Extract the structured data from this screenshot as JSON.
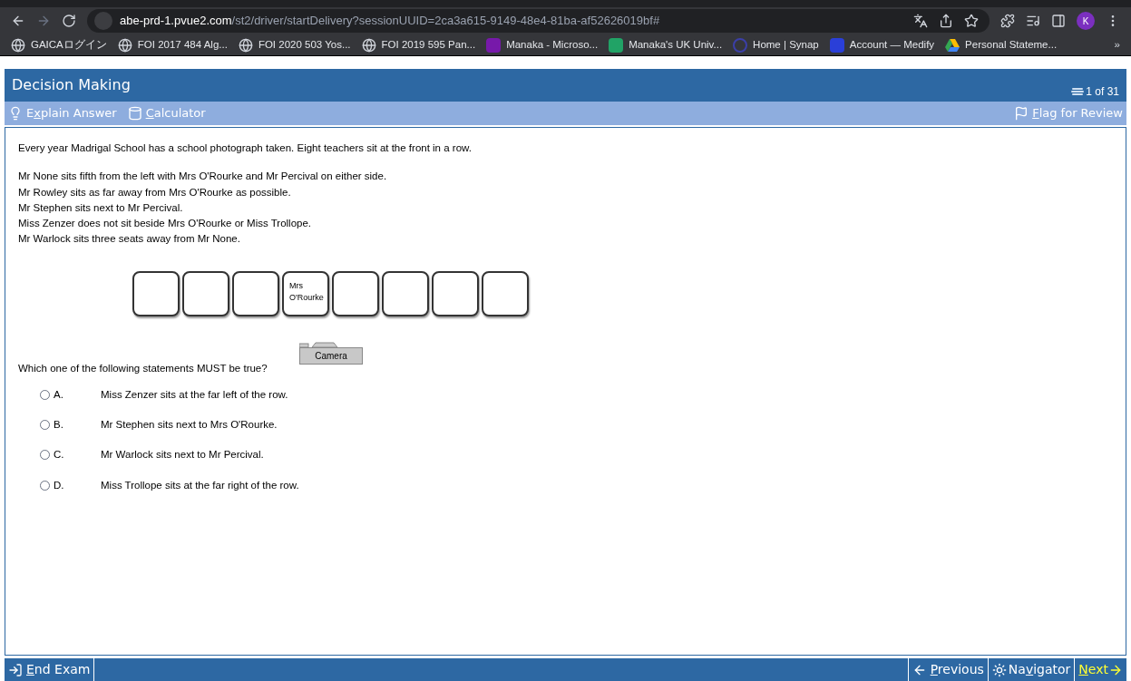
{
  "browser": {
    "url_host": "abe-prd-1.pvue2.com",
    "url_path": "/st2/driver/startDelivery?sessionUUID=2ca3a615-9149-48e4-81ba-af52626019bf#",
    "profile_initial": "K",
    "bookmarks": [
      {
        "label": "GAICAログイン",
        "kind": "globe"
      },
      {
        "label": "FOI 2017 484 Alg...",
        "kind": "globe"
      },
      {
        "label": "FOI 2020 503 Yos...",
        "kind": "globe"
      },
      {
        "label": "FOI 2019 595 Pan...",
        "kind": "globe"
      },
      {
        "label": "Manaka - Microso...",
        "kind": "onenote"
      },
      {
        "label": "Manaka's UK Univ...",
        "kind": "sheet"
      },
      {
        "label": "Home | Synap",
        "kind": "synap"
      },
      {
        "label": "Account — Medify",
        "kind": "medify"
      },
      {
        "label": "Personal Stateme...",
        "kind": "drive"
      }
    ],
    "overflow": "»"
  },
  "exam": {
    "section_title": "Decision Making",
    "progress": "1 of 31",
    "toolbar_left": [
      {
        "kind": "bulb",
        "before": "E",
        "key": "x",
        "after": "plain Answer"
      },
      {
        "kind": "calculator",
        "key": "C",
        "after": "alculator"
      }
    ],
    "flag": {
      "key": "F",
      "after": "lag for Review"
    },
    "stem": "Every year Madrigal School has a school photograph taken. Eight teachers sit at the front in a row.",
    "clues": [
      "Mr None sits fifth from the left with Mrs O'Rourke and Mr Percival on either side.",
      "Mr Rowley sits as far away from Mrs O'Rourke as possible.",
      "Mr Stephen sits next to Mr Percival.",
      "Miss Zenzer does not sit beside Mrs O'Rourke or Miss Trollope.",
      "Mr Warlock sits three seats away from Mr None."
    ],
    "seats": [
      {
        "kind": "empty"
      },
      {
        "kind": "empty"
      },
      {
        "kind": "empty"
      },
      {
        "kind": "named",
        "lines": [
          "Mrs",
          "O'Rourke"
        ]
      },
      {
        "kind": "empty"
      },
      {
        "kind": "empty"
      },
      {
        "kind": "empty"
      },
      {
        "kind": "empty"
      }
    ],
    "camera_label": "Camera",
    "question": "Which one of the following statements MUST be true?",
    "options": [
      {
        "letter": "A.",
        "text": "Miss Zenzer sits at the far left of the row.",
        "selected": false
      },
      {
        "letter": "B.",
        "text": "Mr Stephen sits next to Mrs O'Rourke.",
        "selected": false
      },
      {
        "letter": "C.",
        "text": "Mr Warlock sits next to Mr Percival.",
        "selected": false
      },
      {
        "letter": "D.",
        "text": "Miss Trollope sits at the far right of the row.",
        "selected": false
      }
    ],
    "footer_left": {
      "key": "E",
      "after": "nd Exam"
    },
    "footer_right": [
      {
        "kind": "previous",
        "key": "P",
        "after": "revious"
      },
      {
        "kind": "navigator",
        "before": "Na",
        "key": "v",
        "after": "igator"
      },
      {
        "kind": "next",
        "key": "N",
        "after": "ext"
      }
    ]
  }
}
